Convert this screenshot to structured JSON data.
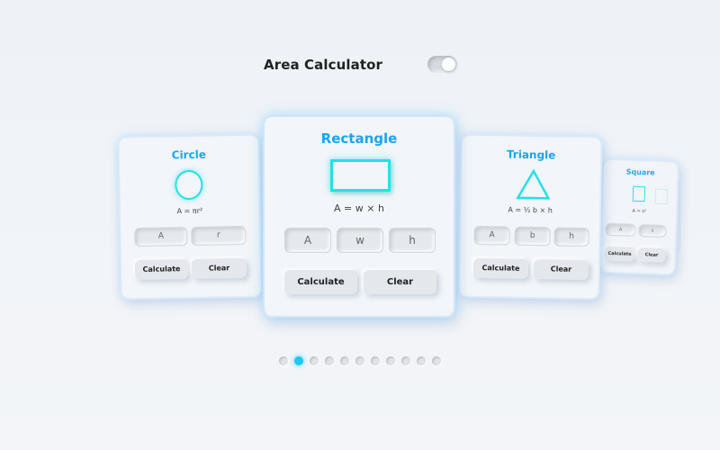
{
  "header": {
    "title": "Area Calculator",
    "theme_toggle": "on"
  },
  "cards": {
    "circle": {
      "title": "Circle",
      "formula": "A = πr²",
      "fields": [
        "A",
        "r"
      ],
      "calculate_label": "Calculate",
      "clear_label": "Clear"
    },
    "rectangle": {
      "title": "Rectangle",
      "formula": "A = w × h",
      "fields": [
        "A",
        "w",
        "h"
      ],
      "calculate_label": "Calculate",
      "clear_label": "Clear"
    },
    "triangle": {
      "title": "Triangle",
      "formula": "A = ½ b × h",
      "fields": [
        "A",
        "b",
        "h"
      ],
      "calculate_label": "Calculate",
      "clear_label": "Clear"
    },
    "square": {
      "title": "Square",
      "formula": "A = s²",
      "fields": [
        "A",
        "s"
      ],
      "calculate_label": "Calculate",
      "clear_label": "Clear"
    }
  },
  "pagination": {
    "total": 11,
    "active": 2
  },
  "colors": {
    "accent": "#1aa5f0",
    "shape_stroke": "#25e0e6",
    "background": "#eef2f7"
  }
}
